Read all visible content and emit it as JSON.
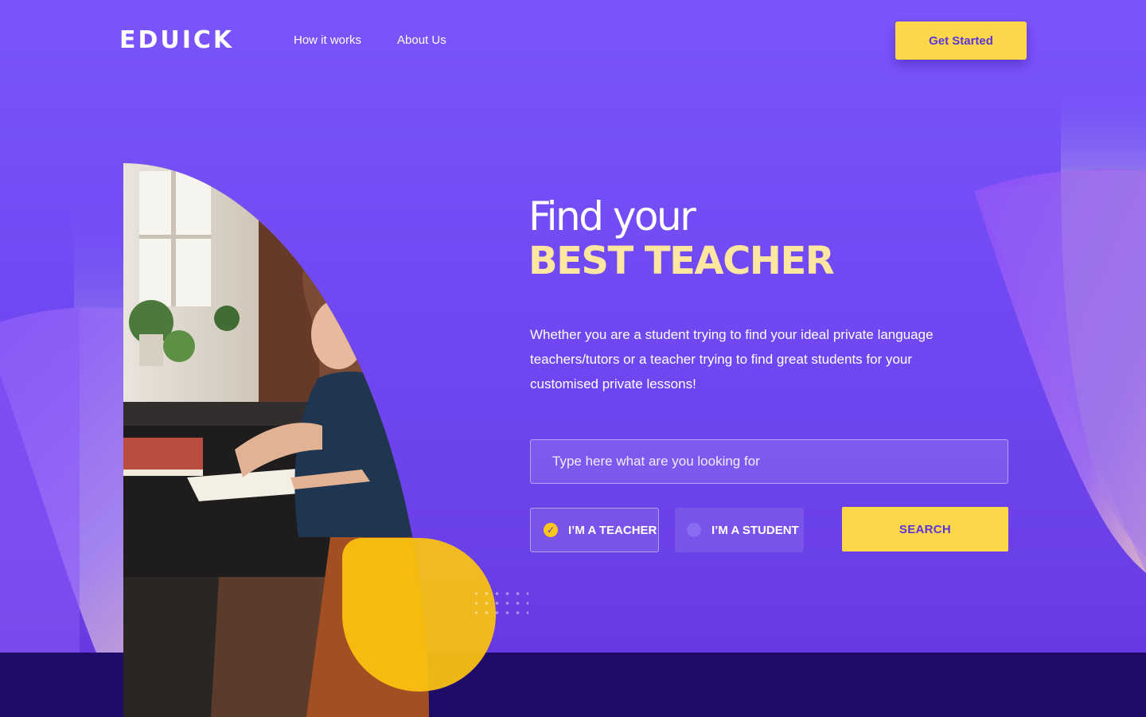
{
  "header": {
    "logo": "EDUICK",
    "nav": [
      {
        "label": "How it works"
      },
      {
        "label": "About Us"
      }
    ],
    "cta_label": "Get Started"
  },
  "hero": {
    "title_line1": "Find your",
    "title_line2": "BEST TEACHER",
    "description": "Whether you are a student trying to find your ideal private language teachers/tutors or a teacher trying to find great students for your customised private lessons!"
  },
  "search": {
    "placeholder": "Type here what are you looking for",
    "value": "",
    "roles": [
      {
        "label": "I’M A TEACHER",
        "selected": true
      },
      {
        "label": "I’M A STUDENT",
        "selected": false
      }
    ],
    "button_label": "SEARCH"
  },
  "colors": {
    "background": "#7b55fb",
    "accent_yellow": "#fdd74a",
    "title_highlight": "#fde6a0",
    "footer_band": "#1f0c68"
  },
  "icons": {
    "selected_radio": "check-icon",
    "unselected_radio": "radio-dot-icon"
  }
}
